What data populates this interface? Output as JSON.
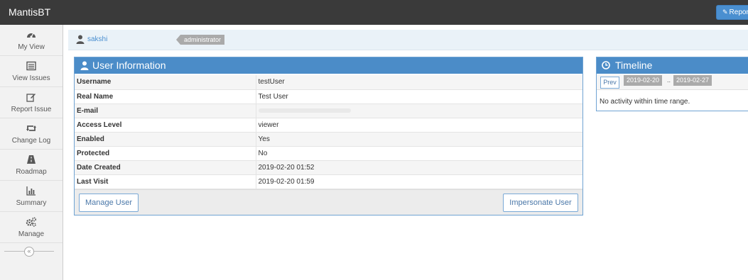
{
  "navbar": {
    "brand": "MantisBT",
    "report_label": "Repor"
  },
  "sidebar": {
    "items": [
      {
        "label": "My View",
        "icon": "dashboard-icon"
      },
      {
        "label": "View Issues",
        "icon": "list-icon"
      },
      {
        "label": "Report Issue",
        "icon": "edit-icon"
      },
      {
        "label": "Change Log",
        "icon": "retweet-icon"
      },
      {
        "label": "Roadmap",
        "icon": "road-icon"
      },
      {
        "label": "Summary",
        "icon": "bar-chart-icon"
      },
      {
        "label": "Manage",
        "icon": "gears-icon"
      }
    ],
    "collapse_glyph": "«"
  },
  "breadcrumb": {
    "username": "sakshi",
    "role": "administrator"
  },
  "user_info": {
    "title": "User Information",
    "rows": [
      {
        "key": "Username",
        "value": "testUser"
      },
      {
        "key": "Real Name",
        "value": "Test User"
      },
      {
        "key": "E-mail",
        "value": ""
      },
      {
        "key": "Access Level",
        "value": "viewer"
      },
      {
        "key": "Enabled",
        "value": "Yes"
      },
      {
        "key": "Protected",
        "value": "No"
      },
      {
        "key": "Date Created",
        "value": "2019-02-20 01:52"
      },
      {
        "key": "Last Visit",
        "value": "2019-02-20 01:59"
      }
    ],
    "manage_button": "Manage User",
    "impersonate_button": "Impersonate User"
  },
  "timeline": {
    "title": "Timeline",
    "prev_label": "Prev",
    "date_from": "2019-02-20",
    "separator": "..",
    "date_to": "2019-02-27",
    "empty_message": "No activity within time range."
  },
  "colors": {
    "navbar": "#3a3a3a",
    "widget_header": "#4b8cc8",
    "accent": "#4a8fd0"
  }
}
